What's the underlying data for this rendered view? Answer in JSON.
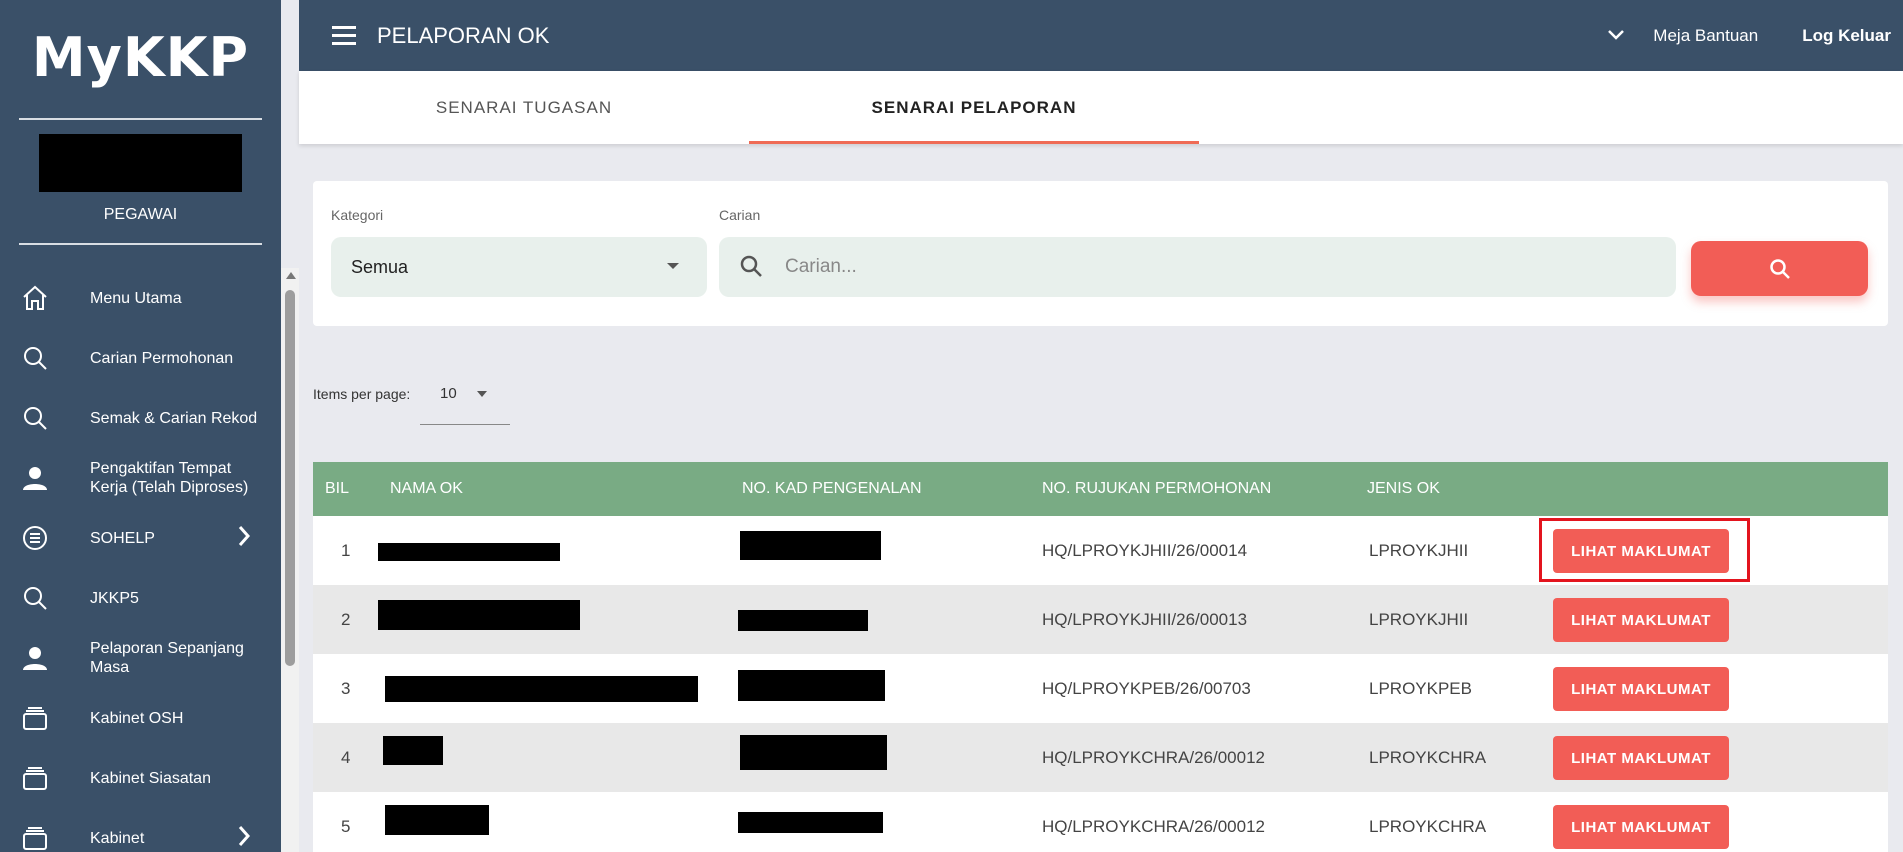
{
  "brand": "MyKKP",
  "user": {
    "role": "PEGAWAI"
  },
  "nav": [
    {
      "label": "Menu Utama",
      "icon": "home-icon",
      "chevron": false
    },
    {
      "label": "Carian Permohonan",
      "icon": "search-icon",
      "chevron": false
    },
    {
      "label": "Semak & Carian Rekod",
      "icon": "search-icon",
      "chevron": false
    },
    {
      "label": "Pengaktifan Tempat Kerja (Telah Diproses)",
      "icon": "person-icon",
      "chevron": false
    },
    {
      "label": "SOHELP",
      "icon": "list-icon",
      "chevron": true
    },
    {
      "label": "JKKP5",
      "icon": "search-icon",
      "chevron": false
    },
    {
      "label": "Pelaporan Sepanjang Masa",
      "icon": "person-icon",
      "chevron": false
    },
    {
      "label": "Kabinet OSH",
      "icon": "cabinet-icon",
      "chevron": false
    },
    {
      "label": "Kabinet Siasatan",
      "icon": "cabinet-icon",
      "chevron": false
    },
    {
      "label": "Kabinet",
      "icon": "cabinet-icon",
      "chevron": true
    }
  ],
  "topbar": {
    "title": "PELAPORAN OK",
    "help": "Meja Bantuan",
    "logout": "Log Keluar"
  },
  "tabs": [
    {
      "label": "SENARAI TUGASAN"
    },
    {
      "label": "SENARAI PELAPORAN"
    }
  ],
  "filter": {
    "kategori_label": "Kategori",
    "kategori_value": "Semua",
    "carian_label": "Carian",
    "carian_placeholder": "Carian..."
  },
  "paginator": {
    "label": "Items per page:",
    "value": "10"
  },
  "table": {
    "headers": {
      "bil": "BIL",
      "nama": "NAMA OK",
      "kad": "NO. KAD PENGENALAN",
      "rujukan": "NO. RUJUKAN PERMOHONAN",
      "jenis": "JENIS OK"
    },
    "action_label": "LIHAT MAKLUMAT",
    "rows": [
      {
        "bil": "1",
        "rujukan": "HQ/LPROYKJHII/26/00014",
        "jenis": "LPROYKJHII"
      },
      {
        "bil": "2",
        "rujukan": "HQ/LPROYKJHII/26/00013",
        "jenis": "LPROYKJHII"
      },
      {
        "bil": "3",
        "rujukan": "HQ/LPROYKPEB/26/00703",
        "jenis": "LPROYKPEB"
      },
      {
        "bil": "4",
        "rujukan": "HQ/LPROYKCHRA/26/00012",
        "jenis": "LPROYKCHRA"
      },
      {
        "bil": "5",
        "rujukan": "HQ/LPROYKCHRA/26/00012",
        "jenis": "LPROYKCHRA"
      }
    ]
  },
  "colors": {
    "sidebar": "#3a5068",
    "accent": "#f25d56",
    "table_header": "#79ab84",
    "tab_indicator": "#ef6b55"
  }
}
